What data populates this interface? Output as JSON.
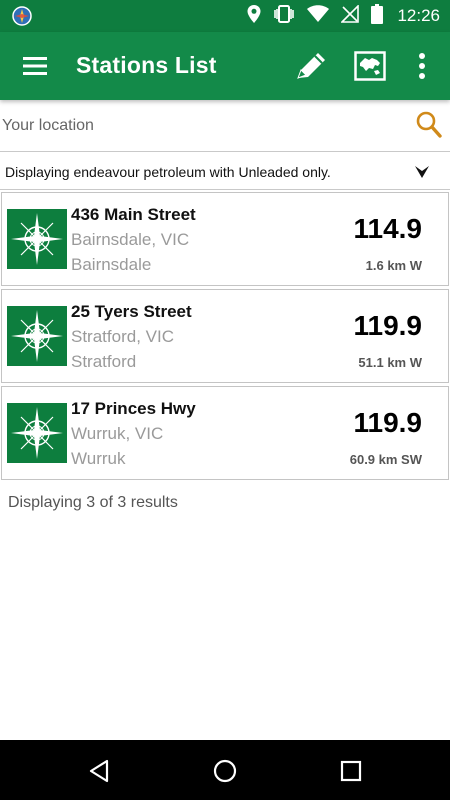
{
  "status_bar": {
    "time": "12:26",
    "icons": [
      "compass-notification-icon",
      "location-icon",
      "vibrate-icon",
      "wifi-icon",
      "no-signal-icon",
      "battery-icon"
    ]
  },
  "app_bar": {
    "title": "Stations List",
    "actions": [
      "menu-icon",
      "pencil-icon",
      "map-icon",
      "overflow-icon"
    ]
  },
  "search": {
    "placeholder": "Your location",
    "value": ""
  },
  "filter": {
    "text": "Displaying endeavour petroleum with Unleaded only."
  },
  "stations": [
    {
      "address": "436 Main Street",
      "city": "Bairnsdale, VIC",
      "suburb": "Bairnsdale",
      "price": "114.9",
      "distance": "1.6 km W"
    },
    {
      "address": "25 Tyers Street",
      "city": "Stratford, VIC",
      "suburb": "Stratford",
      "price": "119.9",
      "distance": "51.1 km W"
    },
    {
      "address": "17 Princes Hwy",
      "city": "Wurruk, VIC",
      "suburb": "Wurruk",
      "price": "119.9",
      "distance": "60.9 km SW"
    }
  ],
  "results_text": "Displaying 3 of 3 results",
  "colors": {
    "primary": "#138a49",
    "status_bar": "#0e7d3f",
    "search_accent": "#d08a1a"
  }
}
